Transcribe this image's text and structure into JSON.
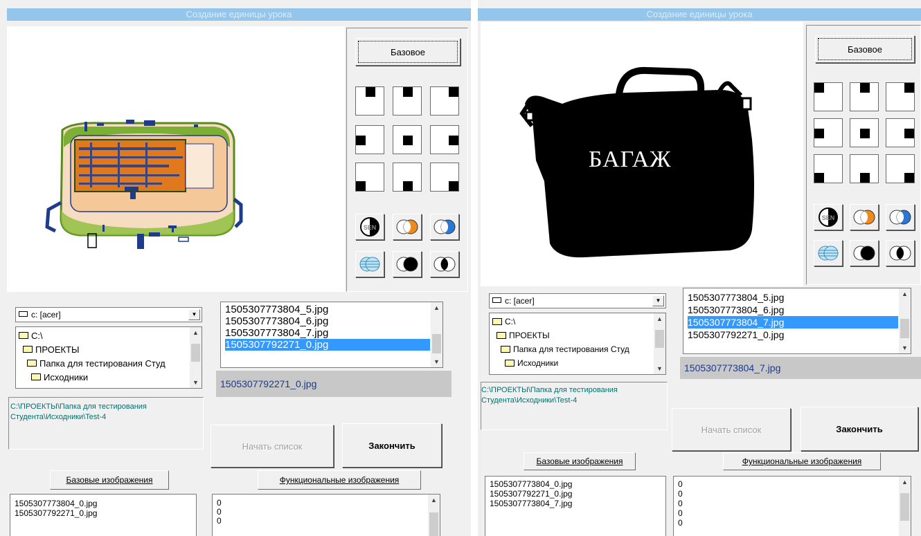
{
  "left": {
    "title": "Создание единицы урока",
    "base_button": "Базовое",
    "drive": "c: [acer]",
    "dirs": [
      "C:\\",
      "ПРОЕКТЫ",
      "Папка для тестирования Студ",
      "Исходники"
    ],
    "files": [
      "1505307773804_5.jpg",
      "1505307773804_6.jpg",
      "1505307773804_7.jpg",
      "1505307792271_0.jpg"
    ],
    "selected_file": "1505307792271_0.jpg",
    "path_line1": "C:\\ПРОЕКТЫ\\Папка для тестирования",
    "path_line2": "Студента\\Исходники\\Test-4",
    "start_list": "Начать список",
    "finish": "Закончить",
    "base_images_label": "Базовые изображения",
    "func_images_label": "Функциональные изображения",
    "base_images": [
      "1505307773804_0.jpg",
      "1505307792271_0.jpg"
    ],
    "func_values": [
      "0",
      "0",
      "0"
    ]
  },
  "right": {
    "title": "Создание единицы урока",
    "base_button": "Базовое",
    "drive": "c: [acer]",
    "dirs": [
      "C:\\",
      "ПРОЕКТЫ",
      "Папка для тестирования Студ",
      "Исходники"
    ],
    "files": [
      "1505307773804_5.jpg",
      "1505307773804_6.jpg",
      "1505307773804_7.jpg",
      "1505307792271_0.jpg"
    ],
    "selected_file": "1505307773804_7.jpg",
    "path_line1": "C:\\ПРОЕКТЫ\\Папка для тестирования",
    "path_line2": "Студента\\Исходники\\Test-4",
    "start_list": "Начать список",
    "finish": "Закончить",
    "base_images_label": "Базовые изображения",
    "func_images_label": "Функциональные изображения",
    "base_images": [
      "1505307773804_0.jpg",
      "1505307792271_0.jpg",
      "1505307773804_7.jpg"
    ],
    "func_values": [
      "0",
      "0",
      "0",
      "0",
      "0"
    ],
    "bag_label": "БАГАЖ"
  },
  "colors": {
    "titlebar": "#94c6ec",
    "selection": "#3399ff",
    "path_text": "#007070",
    "selected_file_text": "#1a3a8c",
    "xray_green": "#6aa626",
    "xray_orange": "#e0781e",
    "xray_blue": "#1f3c8c"
  },
  "icons": [
    "sen-filter-icon",
    "orange-overlap-icon",
    "blue-overlap-icon",
    "striped-overlap-icon",
    "black-overlap-icon",
    "inverse-overlap-icon"
  ]
}
